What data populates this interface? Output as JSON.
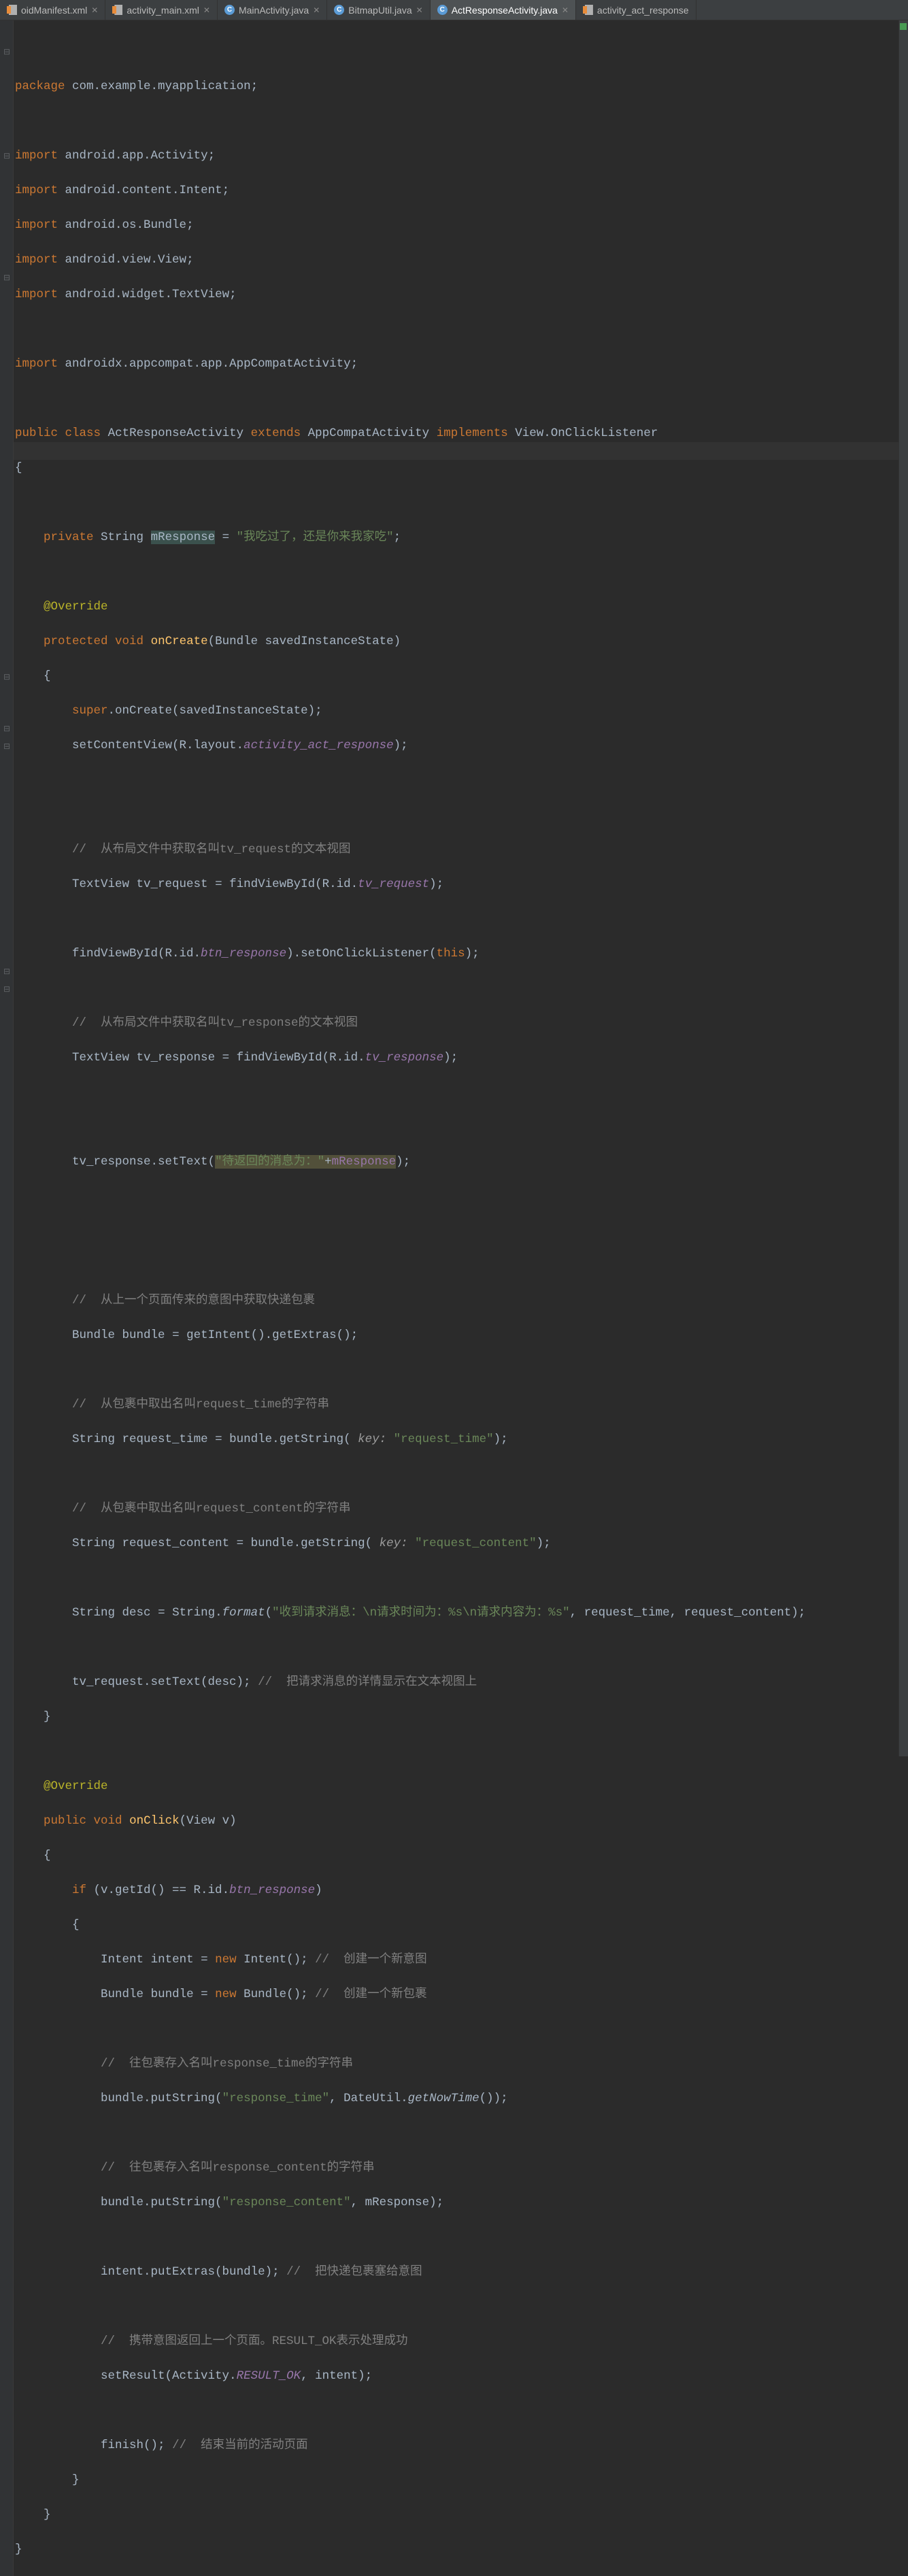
{
  "tabs": [
    {
      "name": "oidManifest.xml",
      "type": "xml",
      "active": false,
      "closable": true
    },
    {
      "name": "activity_main.xml",
      "type": "xml",
      "active": false,
      "closable": true
    },
    {
      "name": "MainActivity.java",
      "type": "java",
      "active": false,
      "closable": true
    },
    {
      "name": "BitmapUtil.java",
      "type": "java",
      "active": false,
      "closable": true
    },
    {
      "name": "ActResponseActivity.java",
      "type": "java",
      "active": true,
      "closable": true
    },
    {
      "name": "activity_act_response",
      "type": "xml",
      "active": false,
      "closable": false
    }
  ],
  "code": {
    "package_stmt": {
      "kw": "package",
      "pkg": "com.example.myapplication",
      "semi": ";"
    },
    "imports": [
      {
        "kw": "import",
        "pkg": "android.app.Activity",
        "semi": ";"
      },
      {
        "kw": "import",
        "pkg": "android.content.Intent",
        "semi": ";"
      },
      {
        "kw": "import",
        "pkg": "android.os.Bundle",
        "semi": ";"
      },
      {
        "kw": "import",
        "pkg": "android.view.View",
        "semi": ";"
      },
      {
        "kw": "import",
        "pkg": "android.widget.TextView",
        "semi": ";"
      }
    ],
    "import_x": {
      "kw": "import",
      "pkg": "androidx.appcompat.app.AppCompatActivity",
      "semi": ";"
    },
    "class_decl": {
      "pub": "public",
      "cls": "class",
      "name": "ActResponseActivity",
      "ext": "extends",
      "sup": "AppCompatActivity",
      "impl": "implements",
      "iface": "View.OnClickListener"
    },
    "field": {
      "priv": "private",
      "type": "String",
      "name": "mResponse",
      "eq": " = ",
      "val": "\"我吃过了，还是你来我家吃\"",
      "semi": ";"
    },
    "override": "@Override",
    "onCreate_sig": {
      "prot": "protected",
      "void": "void",
      "name": "onCreate",
      "open": "(",
      "ptype": "Bundle",
      "pname": "savedInstanceState",
      "close": ")"
    },
    "super_call": {
      "sup": "super",
      "dot": ".onCreate(savedInstanceState);"
    },
    "setContent": {
      "fn": "setContentView(R.layout.",
      "res": "activity_act_response",
      "close": ");"
    },
    "cmt1": "//  从布局文件中获取名叫tv_request的文本视图",
    "tvreq": {
      "type": "TextView",
      "name": "tv_request",
      "eq": " = findViewById(R.id.",
      "res": "tv_request",
      "close": ");"
    },
    "findbtn": {
      "pre": "findViewById(R.id.",
      "res": "btn_response",
      "post": ").setOnClickListener(",
      "this": "this",
      "close": ");"
    },
    "cmt2": "//  从布局文件中获取名叫tv_response的文本视图",
    "tvresp": {
      "type": "TextView",
      "name": "tv_response",
      "eq": " = findViewById(R.id.",
      "res": "tv_response",
      "close": ");"
    },
    "settext": {
      "pre": "tv_response.setText(",
      "s1": "\"待返回的消息为：\"",
      "plus": "+",
      "fld": "mResponse",
      "close": ");"
    },
    "cmt3": "//  从上一个页面传来的意图中获取快递包裹",
    "bundle_get": {
      "type": "Bundle",
      "name": "bundle",
      "eq": " = getIntent().getExtras();"
    },
    "cmt4": "//  从包裹中取出名叫request_time的字符串",
    "req_time": {
      "type": "String",
      "name": "request_time",
      "eq": " = bundle.getString(",
      "hint": " key: ",
      "val": "\"request_time\"",
      "close": ");"
    },
    "cmt5": "//  从包裹中取出名叫request_content的字符串",
    "req_content": {
      "type": "String",
      "name": "request_content",
      "eq": " = bundle.getString(",
      "hint": " key: ",
      "val": "\"request_content\"",
      "close": ");"
    },
    "desc": {
      "type": "String",
      "name": "desc",
      "eq": " = String.",
      "fn": "format",
      "open": "(",
      "fmt": "\"收到请求消息：\\n请求时间为：%s\\n请求内容为：%s\"",
      "rest": ", request_time, request_content);"
    },
    "tvset": {
      "pre": "tv_request.setText(desc); ",
      "cmt": "//  把请求消息的详情显示在文本视图上"
    },
    "onClick_sig": {
      "pub": "public",
      "void": "void",
      "name": "onClick",
      "open": "(",
      "ptype": "View",
      "pname": "v",
      "close": ")"
    },
    "if_stmt": {
      "if": "if",
      "open": " (v.getId() == R.id.",
      "res": "btn_response",
      "close": ")"
    },
    "intent_new": {
      "type": "Intent",
      "name": "intent",
      "eq": " = ",
      "new": "new",
      "ctor": " Intent(); ",
      "cmt": "//  创建一个新意图"
    },
    "bundle_new": {
      "type": "Bundle",
      "name": "bundle",
      "eq": " = ",
      "new": "new",
      "ctor": " Bundle(); ",
      "cmt": "//  创建一个新包裹"
    },
    "cmt6": "//  往包裹存入名叫response_time的字符串",
    "put_time": {
      "pre": "bundle.putString(",
      "k": "\"response_time\"",
      "mid": ", DateUtil.",
      "fn": "getNowTime",
      "close": "());"
    },
    "cmt7": "//  往包裹存入名叫response_content的字符串",
    "put_content": {
      "pre": "bundle.putString(",
      "k": "\"response_content\"",
      "mid": ", mResponse);"
    },
    "putExtras": {
      "pre": "intent.putExtras(bundle); ",
      "cmt": "//  把快递包裹塞给意图"
    },
    "cmt8": "//  携带意图返回上一个页面。RESULT_OK表示处理成功",
    "setResult": {
      "pre": "setResult(Activity.",
      "fld": "RESULT_OK",
      "post": ", intent);"
    },
    "finish": {
      "pre": "finish(); ",
      "cmt": "//  结束当前的活动页面"
    }
  }
}
